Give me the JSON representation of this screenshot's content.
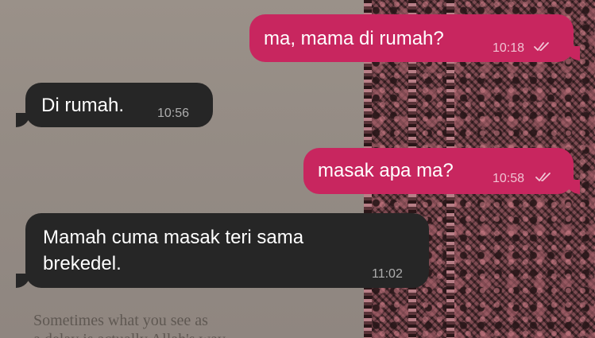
{
  "wallpaper": {
    "partial_line": "",
    "line_1": "Sometimes what you see as",
    "line_2": "a delay is actually Allah's way"
  },
  "messages": [
    {
      "direction": "outgoing",
      "text": "ma, mama di rumah?",
      "time": "10:18",
      "status": "read"
    },
    {
      "direction": "incoming",
      "text": "Di rumah.",
      "time": "10:56"
    },
    {
      "direction": "outgoing",
      "text": "masak apa ma?",
      "time": "10:58",
      "status": "read"
    },
    {
      "direction": "incoming",
      "text_line_1": "Mamah cuma masak teri sama",
      "text_line_2": "brekedel.",
      "time": "11:02"
    }
  ],
  "colors": {
    "outgoing_bubble": "#c8265f",
    "incoming_bubble": "#262626",
    "bubble_text": "#ffffff"
  },
  "icons": {
    "read_status": "double-check-icon"
  }
}
